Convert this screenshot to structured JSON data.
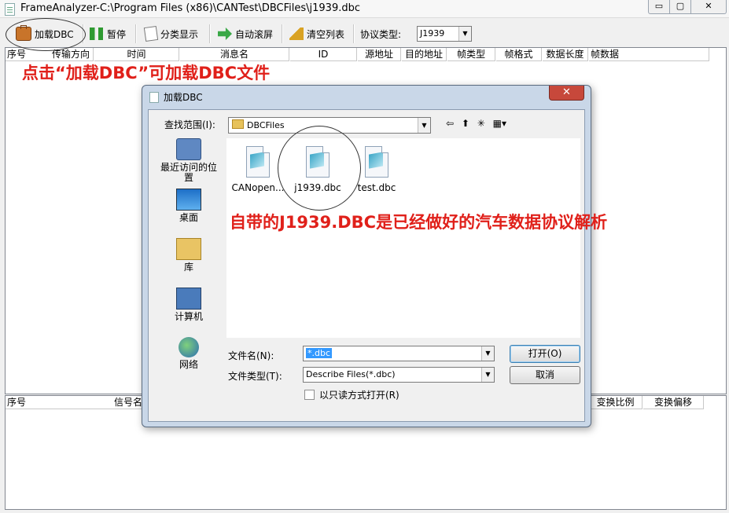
{
  "window": {
    "title": "FrameAnalyzer-C:\\Program Files (x86)\\CANTest\\DBCFiles\\j1939.dbc",
    "min_glyph": "▭",
    "max_glyph": "▢",
    "close_glyph": "✕"
  },
  "toolbar": {
    "load_dbc": "加载DBC",
    "pause": "暂停",
    "classify": "分类显示",
    "autoscroll": "自动滚屏",
    "clear": "清空列表",
    "protocol_label": "协议类型:",
    "protocol_value": "J1939",
    "dropdown_glyph": "▼"
  },
  "top_grid": {
    "columns": [
      "序号",
      "传输方向",
      "时间",
      "消息名",
      "ID",
      "源地址",
      "目的地址",
      "帧类型",
      "帧格式",
      "数据长度",
      "帧数据"
    ]
  },
  "bottom_grid": {
    "columns_left": [
      "序号",
      "信号名"
    ],
    "columns_right": [
      "变换比例",
      "变换偏移"
    ]
  },
  "annotations": {
    "top": "点击“加载DBC”可加载DBC文件",
    "middle": "自带的J1939.DBC是已经做好的汽车数据协议解析"
  },
  "dialog": {
    "title": "加载DBC",
    "close_glyph": "✕",
    "look_in_label": "查找范围(I):",
    "look_in_value": "DBCFiles",
    "nav": {
      "back": "⇦",
      "up": "⬆",
      "newfolder": "✳",
      "view": "▦▾"
    },
    "places": [
      {
        "label": "最近访问的位置",
        "icon": "recent-places-icon"
      },
      {
        "label": "桌面",
        "icon": "desktop-icon"
      },
      {
        "label": "库",
        "icon": "libraries-icon"
      },
      {
        "label": "计算机",
        "icon": "computer-icon"
      },
      {
        "label": "网络",
        "icon": "network-icon"
      }
    ],
    "files": [
      "CANopen...",
      "j1939.dbc",
      "test.dbc"
    ],
    "filename_label": "文件名(N):",
    "filename_value": "*.dbc",
    "filetype_label": "文件类型(T):",
    "filetype_value": "Describe Files(*.dbc)",
    "open_button": "打开(O)",
    "cancel_button": "取消",
    "readonly_label": "以只读方式打开(R)"
  }
}
